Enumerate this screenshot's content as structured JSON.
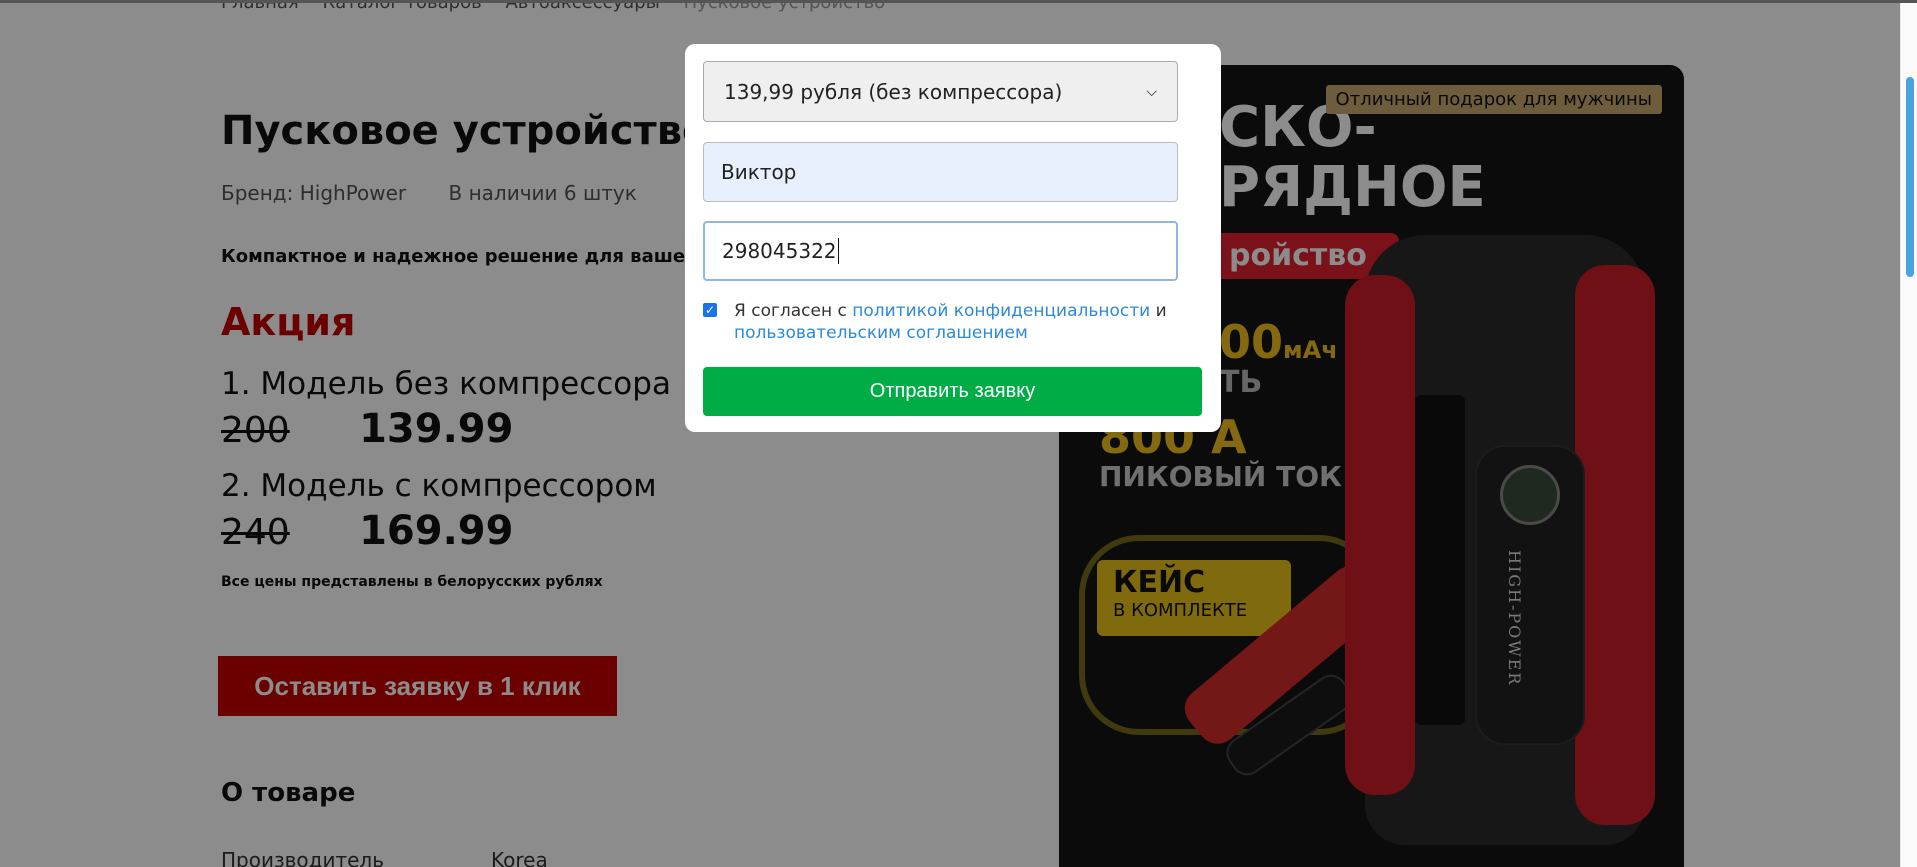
{
  "breadcrumb": {
    "items": [
      "Главная",
      "Каталог товаров",
      "Автоаксессуары"
    ],
    "current": "Пусковое устройство"
  },
  "product": {
    "title": "Пусковое устройство",
    "brand": "Бренд: HighPower",
    "stock": "В наличии 6 штук",
    "description": "Компактное и надежное решение для ваше",
    "promo_heading": "Акция",
    "models": [
      {
        "label": "1. Модель без компрессора",
        "old_price": "200",
        "new_price": "139.99"
      },
      {
        "label": "2. Модель с компрессором",
        "old_price": "240",
        "new_price": "169.99"
      }
    ],
    "price_note": "Все цены представлены в белорусских рублях",
    "cta_label": "Оставить заявку в 1 клик",
    "about_heading": "О товаре",
    "spec_key": "Производитель",
    "spec_value": "Korea"
  },
  "banner": {
    "gift_badge": "Отличный подарок для мужчины",
    "headline_1": "СКО-",
    "headline_2": "РЯДНОЕ",
    "red_tag": "ройство",
    "capacity": "00",
    "capacity_unit": "мАч",
    "gray_line": "ТЬ",
    "amps": "800 А",
    "peak": "ПИКОВЫЙ ТОК",
    "case_title": "КЕЙС",
    "case_sub": "В КОМПЛЕКТЕ",
    "device_brand": "HIGH-POWER"
  },
  "modal": {
    "select_value": "139,99 рубля (без компрессора)",
    "name_value": "Виктор",
    "phone_value": "298045322",
    "agree_prefix": "Я согласен с",
    "privacy_link": "политикой конфиденциальности",
    "agree_and": "и",
    "terms_link": "пользовательским соглашением",
    "submit_label": "Отправить заявку"
  },
  "colors": {
    "accent_red": "#c40000",
    "submit_green": "#00ac45",
    "link_blue": "#2b8ad8"
  }
}
